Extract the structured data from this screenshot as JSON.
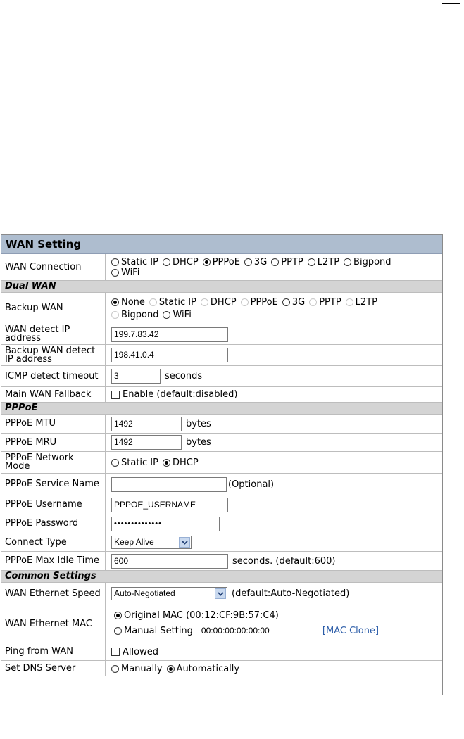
{
  "title": "WAN Setting",
  "wan_connection": {
    "label": "WAN Connection",
    "options": [
      "Static IP",
      "DHCP",
      "PPPoE",
      "3G",
      "PPTP",
      "L2TP",
      "Bigpond",
      "WiFi"
    ],
    "selected": "PPPoE"
  },
  "sections": {
    "dual_wan": "Dual WAN",
    "pppoe": "PPPoE",
    "common": "Common Settings"
  },
  "backup_wan": {
    "label": "Backup WAN",
    "options": [
      "None",
      "Static IP",
      "DHCP",
      "PPPoE",
      "3G",
      "PPTP",
      "L2TP",
      "Bigpond",
      "WiFi"
    ],
    "selected": "None"
  },
  "wan_detect_ip": {
    "label": "WAN detect IP address",
    "value": "199.7.83.42"
  },
  "backup_detect_ip": {
    "label": "Backup WAN detect IP address",
    "value": "198.41.0.4"
  },
  "icmp_timeout": {
    "label": "ICMP detect timeout",
    "value": "3",
    "unit": "seconds"
  },
  "main_fallback": {
    "label": "Main WAN Fallback",
    "checkbox_label": "Enable (default:disabled)"
  },
  "pppoe_mtu": {
    "label": "PPPoE MTU",
    "value": "1492",
    "unit": "bytes"
  },
  "pppoe_mru": {
    "label": "PPPoE MRU",
    "value": "1492",
    "unit": "bytes"
  },
  "pppoe_network_mode": {
    "label": "PPPoE Network Mode",
    "options": [
      "Static IP",
      "DHCP"
    ],
    "selected": "DHCP"
  },
  "pppoe_service_name": {
    "label": "PPPoE Service Name",
    "value": "",
    "suffix": "(Optional)"
  },
  "pppoe_username": {
    "label": "PPPoE Username",
    "value": "PPPOE_USERNAME"
  },
  "pppoe_password": {
    "label": "PPPoE Password",
    "masked_value": "••••••••••••••"
  },
  "connect_type": {
    "label": "Connect Type",
    "value": "Keep Alive"
  },
  "pppoe_max_idle": {
    "label": "PPPoE Max Idle Time",
    "value": "600",
    "suffix": "seconds. (default:600)"
  },
  "wan_ethernet_speed": {
    "label": "WAN Ethernet Speed",
    "value": "Auto-Negotiated",
    "suffix": "(default:Auto-Negotiated)"
  },
  "wan_ethernet_mac": {
    "label": "WAN Ethernet MAC",
    "original_label": "Original MAC (00:12:CF:9B:57:C4)",
    "manual_label": "Manual Setting",
    "manual_value": "00:00:00:00:00:00",
    "clone_link": "[MAC Clone]"
  },
  "ping_from_wan": {
    "label": "Ping from WAN",
    "checkbox_label": "Allowed"
  },
  "dns_server": {
    "label": "Set DNS Server",
    "options": [
      "Manually",
      "Automatically"
    ],
    "selected": "Automatically"
  },
  "colors": {
    "title_bar": "#aebdcf",
    "section_bar": "#d4d4d4",
    "link": "#2b5ca8"
  }
}
